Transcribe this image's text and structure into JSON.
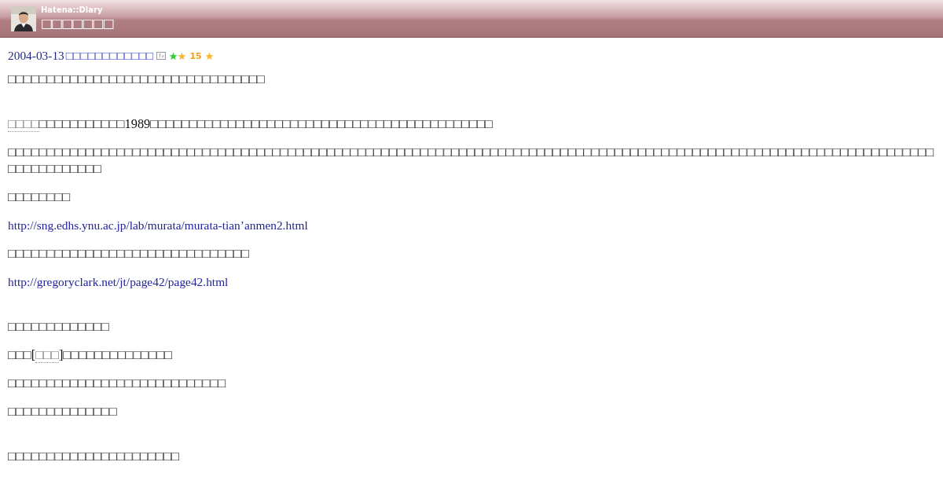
{
  "header": {
    "brand": "Hatena::Diary",
    "title": "□□□□□□□"
  },
  "entry": {
    "date": "2004-03-13",
    "title": "□□□□□□□□□□□□",
    "star_marks": [
      {
        "color": "#33cc33"
      },
      {
        "color": "#f5b82e"
      }
    ],
    "star_count": "15"
  },
  "paragraphs": [
    [
      {
        "kind": "text",
        "text": "□□□□□□□□□□□□□□□□□□□□□□□□□□□□□□□□□"
      }
    ],
    [
      {
        "kind": "gap"
      }
    ],
    [
      {
        "kind": "keyword",
        "text": "□□□□"
      },
      {
        "kind": "text",
        "text": "□□□□□□□□□□□1989□□□□□□□□□□□□□□□□□□□□□□□□□□□□□□□□□□□□□□□□□□□□"
      }
    ],
    [
      {
        "kind": "text",
        "text": "□□□□□□□□□□□□□□□□□□□□□□□□□□□□□□□□□□□□□□□□□□□□□□□□□□□□□□□□□□□□□□□□□□□□□□□□□□□□□□□□□□□□□□□□□□□□□□□□□□□□□□□□□□□□□□□□□□□□□□□□□□□□□□□□□□□"
      }
    ],
    [
      {
        "kind": "text",
        "text": "□□□□□□□□"
      }
    ],
    [
      {
        "kind": "link",
        "text": "http://sng.edhs.ynu.ac.jp/lab/murata/murata-tian’anmen2.html"
      }
    ],
    [
      {
        "kind": "text",
        "text": "□□□□□□□□□□□□□□□□□□□□□□□□□□□□□□□"
      }
    ],
    [
      {
        "kind": "link",
        "text": "http://gregoryclark.net/jt/page42/page42.html"
      }
    ],
    [
      {
        "kind": "gap"
      }
    ],
    [
      {
        "kind": "text",
        "text": "□□□□□□□□□□□□□"
      }
    ],
    [
      {
        "kind": "text",
        "text": "□□□["
      },
      {
        "kind": "keyword",
        "text": "□□□"
      },
      {
        "kind": "text",
        "text": "]□□□□□□□□□□□□□□"
      }
    ],
    [
      {
        "kind": "text",
        "text": "□□□□□□□□□□□□□□□□□□□□□□□□□□□□"
      }
    ],
    [
      {
        "kind": "text",
        "text": "□□□□□□□□□□□□□□"
      }
    ],
    [
      {
        "kind": "gap"
      }
    ],
    [
      {
        "kind": "text",
        "text": "□□□□□□□□□□□□□□□□□□□□□□"
      }
    ]
  ]
}
